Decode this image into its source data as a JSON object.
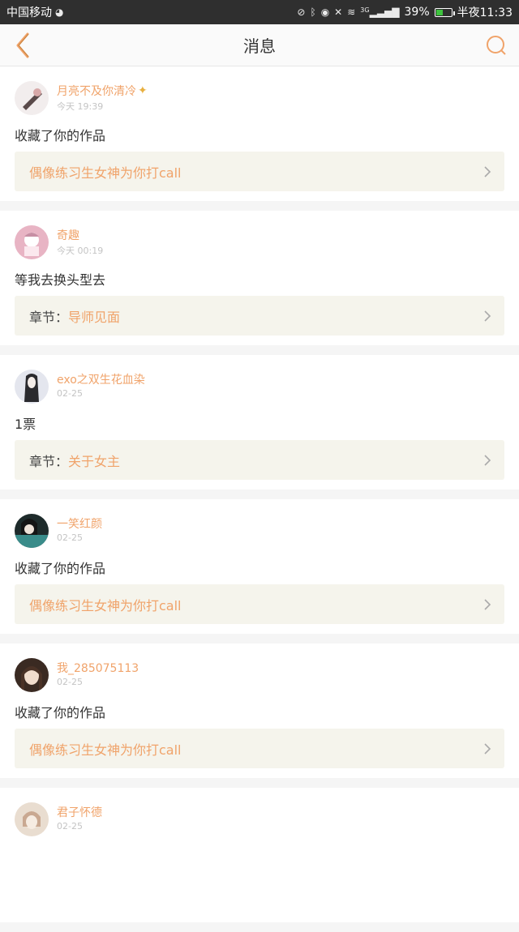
{
  "status_bar": {
    "carrier": "中国移动",
    "battery": "39%",
    "time": "半夜11:33",
    "network": "3G"
  },
  "nav": {
    "title": "消息",
    "accent": "#f0a36a"
  },
  "messages": [
    {
      "user": "月亮不及你清冷",
      "time": "今天 19:39",
      "content": "收藏了你的作品",
      "ref_prefix": "",
      "ref_text": "偶像练习生女神为你打call",
      "avatar_color": "#d9c3c3",
      "badge": true
    },
    {
      "user": "奇趣",
      "time": "今天 00:19",
      "content": "等我去换头型去",
      "ref_prefix": "章节：",
      "ref_text": "导师见面",
      "avatar_color": "#e8b4c4",
      "badge": false
    },
    {
      "user": "exo之双生花血染",
      "time": "02-25",
      "content": "1票",
      "ref_prefix": "章节：",
      "ref_text": "关于女主",
      "avatar_color": "#b8bcc8",
      "badge": false
    },
    {
      "user": "一笑红颜",
      "time": "02-25",
      "content": "收藏了你的作品",
      "ref_prefix": "",
      "ref_text": "偶像练习生女神为你打call",
      "avatar_color": "#3a8c8a",
      "badge": false
    },
    {
      "user": "我_285075113",
      "time": "02-25",
      "content": "收藏了你的作品",
      "ref_prefix": "",
      "ref_text": "偶像练习生女神为你打call",
      "avatar_color": "#6b4a3a",
      "badge": false
    },
    {
      "user": "君子怀德",
      "time": "02-25",
      "content": "",
      "ref_prefix": "",
      "ref_text": "",
      "avatar_color": "#d7c7b5",
      "badge": false
    }
  ]
}
